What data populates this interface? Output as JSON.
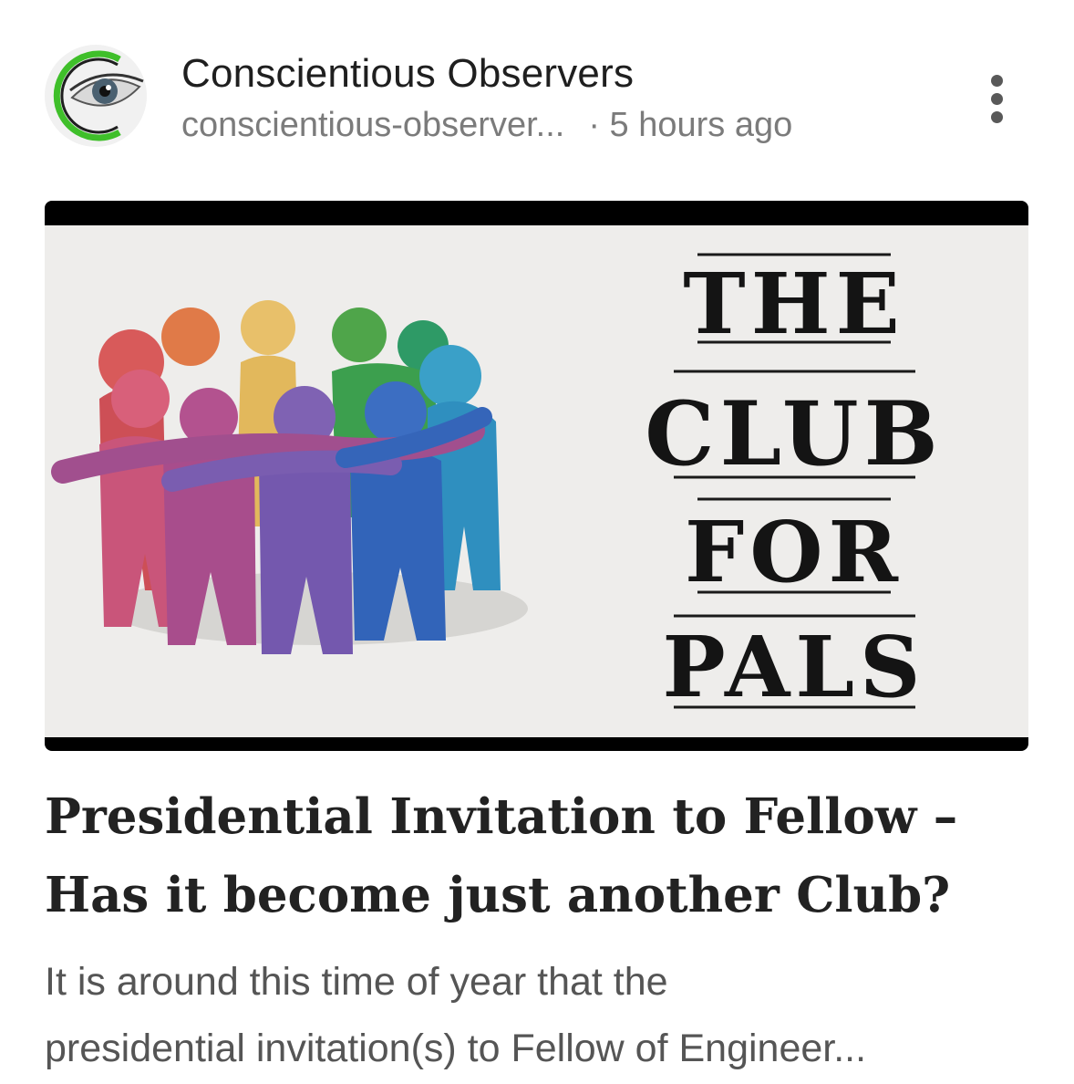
{
  "header": {
    "publication_name": "Conscientious Observers",
    "publication_handle": "conscientious-observer...",
    "separator": "·",
    "time_ago": "5 hours ago",
    "avatar_icon": "eye-logo-icon",
    "more_icon": "vertical-ellipsis-icon"
  },
  "hero_image": {
    "icon": "clay-figures-circle-illustration",
    "stencil_lines": [
      "THE",
      "CLUB",
      "FOR",
      "PALS"
    ]
  },
  "article": {
    "title_line1": "Presidential Invitation to Fellow –",
    "title_line2": "Has it become just another Club?",
    "excerpt_line1": "It is around this time of year that the",
    "excerpt_line2": "presidential invitation(s) to Fellow of Engineer..."
  },
  "colors": {
    "logo_ring": "#3fbf2a",
    "text_primary": "#1f1f1f",
    "text_secondary": "#7b7b7b",
    "hero_bg": "#eeedeb"
  }
}
